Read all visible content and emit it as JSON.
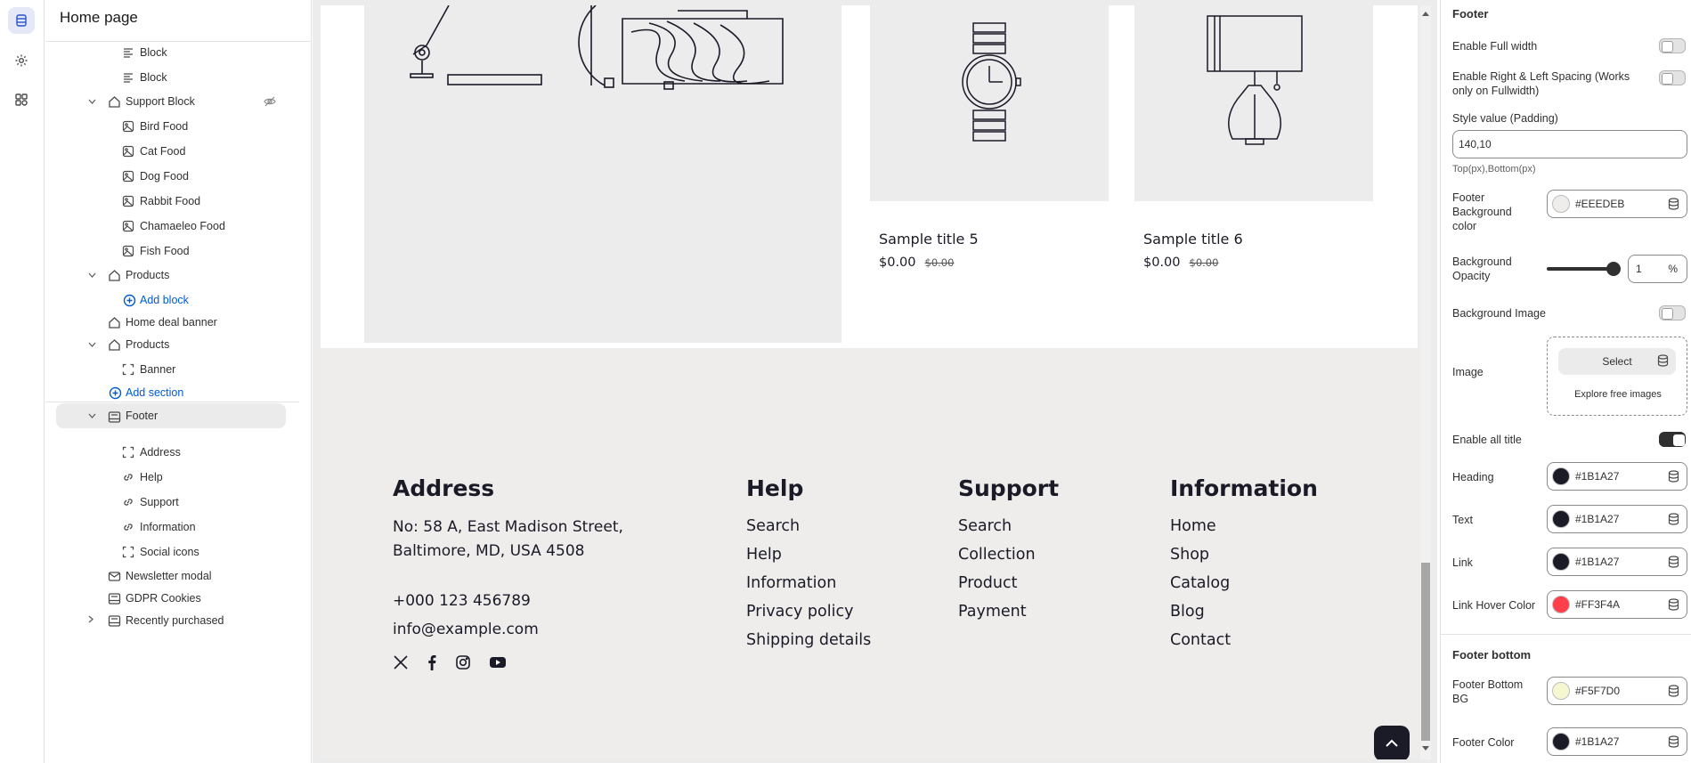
{
  "sidebar": {
    "title": "Home page",
    "items": [
      {
        "label": "Block",
        "icon": "text-align-icon"
      },
      {
        "label": "Block",
        "icon": "text-align-icon"
      },
      {
        "label": "Support Block",
        "icon": "section-icon"
      },
      {
        "label": "Bird Food",
        "icon": "image-block-icon"
      },
      {
        "label": "Cat Food",
        "icon": "image-block-icon"
      },
      {
        "label": "Dog Food",
        "icon": "image-block-icon"
      },
      {
        "label": "Rabbit Food",
        "icon": "image-block-icon"
      },
      {
        "label": "Chamaeleo Food",
        "icon": "image-block-icon"
      },
      {
        "label": "Fish Food",
        "icon": "image-block-icon"
      },
      {
        "label": "Products",
        "icon": "section-icon"
      },
      {
        "label": "Add block",
        "icon": "plus-circle-icon"
      },
      {
        "label": "Home deal banner",
        "icon": "section-icon"
      },
      {
        "label": "Products",
        "icon": "section-icon"
      },
      {
        "label": "Banner",
        "icon": "frame-icon"
      },
      {
        "label": "Add section",
        "icon": "plus-circle-icon"
      },
      {
        "label": "Footer",
        "icon": "footer-icon"
      },
      {
        "label": "Address",
        "icon": "frame-icon"
      },
      {
        "label": "Help",
        "icon": "link-icon"
      },
      {
        "label": "Support",
        "icon": "link-icon"
      },
      {
        "label": "Information",
        "icon": "link-icon"
      },
      {
        "label": "Social icons",
        "icon": "frame-icon"
      },
      {
        "label": "Newsletter modal",
        "icon": "mail-icon"
      },
      {
        "label": "GDPR Cookies",
        "icon": "footer-icon"
      },
      {
        "label": "Recently purchased",
        "icon": "footer-icon"
      }
    ]
  },
  "preview": {
    "products": [
      {
        "title": "Sample title 5",
        "price": "$0.00",
        "compare_price": "$0.00",
        "image": "watch"
      },
      {
        "title": "Sample title 6",
        "price": "$0.00",
        "compare_price": "$0.00",
        "image": "lamp"
      }
    ],
    "footer": {
      "address": {
        "heading": "Address",
        "line1": "No: 58 A, East Madison Street,",
        "line2": "Baltimore, MD, USA 4508",
        "phone": "+000 123 456789",
        "email": "info@example.com"
      },
      "help": {
        "heading": "Help",
        "links": [
          "Search",
          "Help",
          "Information",
          "Privacy policy",
          "Shipping details"
        ]
      },
      "support": {
        "heading": "Support",
        "links": [
          "Search",
          "Collection",
          "Product",
          "Payment"
        ]
      },
      "information": {
        "heading": "Information",
        "links": [
          "Home",
          "Shop",
          "Catalog",
          "Blog",
          "Contact"
        ]
      },
      "social_icons": [
        "x-icon",
        "facebook-icon",
        "instagram-icon",
        "youtube-icon"
      ]
    }
  },
  "settings": {
    "title": "Footer",
    "enable_full_width": {
      "label": "Enable Full width",
      "on": false
    },
    "enable_spacing": {
      "label": "Enable Right & Left Spacing (Works only on Fullwidth)",
      "on": false
    },
    "style_value": {
      "label": "Style value (Padding)",
      "value": "140,10",
      "hint": "Top(px),Bottom(px)"
    },
    "footer_bg": {
      "label": "Footer Background color",
      "value": "#EEEDEB",
      "swatch": "#EEEDEB"
    },
    "bg_opacity": {
      "label": "Background Opacity",
      "value": "1",
      "unit": "%",
      "level": 1.0
    },
    "bg_image": {
      "label": "Background Image",
      "on": false
    },
    "image": {
      "label": "Image",
      "select": "Select",
      "explore": "Explore free images"
    },
    "enable_all_title": {
      "label": "Enable all title",
      "on": true
    },
    "heading": {
      "label": "Heading",
      "value": "#1B1A27",
      "swatch": "#1B1A27"
    },
    "text": {
      "label": "Text",
      "value": "#1B1A27",
      "swatch": "#1B1A27"
    },
    "link": {
      "label": "Link",
      "value": "#1B1A27",
      "swatch": "#1B1A27"
    },
    "link_hover": {
      "label": "Link Hover Color",
      "value": "#FF3F4A",
      "swatch": "#FF3F4A"
    },
    "footer_bottom_title": "Footer bottom",
    "footer_bottom_bg": {
      "label": "Footer Bottom BG",
      "value": "#F5F7D0",
      "swatch": "#F5F7D0"
    },
    "footer_color": {
      "label": "Footer Color",
      "value": "#1B1A27",
      "swatch": "#1B1A27"
    }
  }
}
